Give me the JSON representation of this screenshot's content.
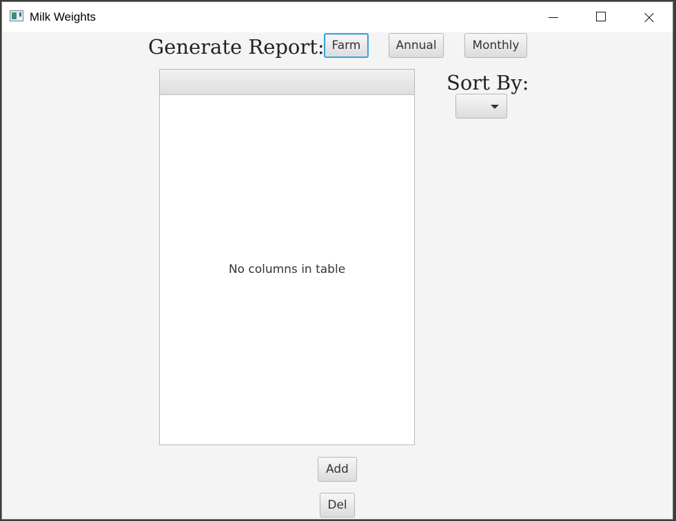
{
  "window": {
    "title": "Milk Weights",
    "icons": {
      "app": "app-window-icon",
      "minimize": "minimize-icon",
      "maximize": "maximize-icon",
      "close": "close-icon"
    }
  },
  "report": {
    "heading": "Generate Report:",
    "buttons": {
      "farm": "Farm",
      "annual": "Annual",
      "monthly": "Monthly"
    },
    "focused_button": "farm"
  },
  "sort": {
    "label": "Sort By:",
    "selected": ""
  },
  "table": {
    "placeholder": "No columns in table",
    "columns": [],
    "rows": []
  },
  "actions": {
    "add": "Add",
    "del": "Del"
  },
  "colors": {
    "focus_ring": "#3aa0d8",
    "window_bg": "#f4f4f4"
  }
}
